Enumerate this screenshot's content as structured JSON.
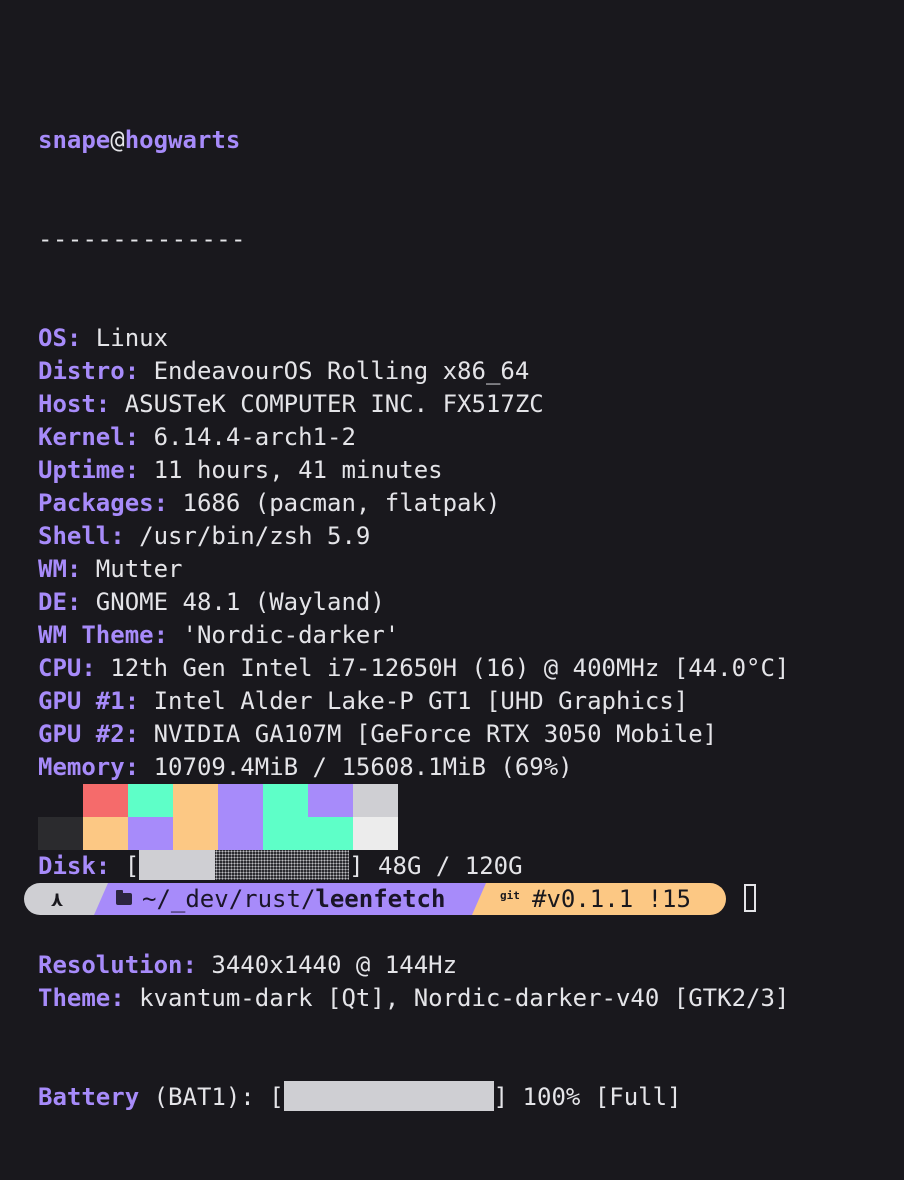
{
  "header": {
    "user": "snape",
    "at": "@",
    "host": "hogwarts",
    "separator": "--------------"
  },
  "info": [
    {
      "label": "OS:",
      "value": " Linux"
    },
    {
      "label": "Distro:",
      "value": " EndeavourOS Rolling x86_64"
    },
    {
      "label": "Host:",
      "value": " ASUSTeK COMPUTER INC. FX517ZC"
    },
    {
      "label": "Kernel:",
      "value": " 6.14.4-arch1-2"
    },
    {
      "label": "Uptime:",
      "value": " 11 hours, 41 minutes"
    },
    {
      "label": "Packages:",
      "value": " 1686 (pacman, flatpak)"
    },
    {
      "label": "Shell:",
      "value": " /usr/bin/zsh 5.9"
    },
    {
      "label": "WM:",
      "value": " Mutter"
    },
    {
      "label": "DE:",
      "value": " GNOME 48.1 (Wayland)"
    },
    {
      "label": "WM Theme:",
      "value": " 'Nordic-darker'"
    },
    {
      "label": "CPU:",
      "value": " 12th Gen Intel i7-12650H (16) @ 400MHz [44.0°C]"
    },
    {
      "label": "GPU #1:",
      "value": " Intel Alder Lake-P GT1 [UHD Graphics]"
    },
    {
      "label": "GPU #2:",
      "value": " NVIDIA GA107M [GeForce RTX 3050 Mobile]"
    },
    {
      "label": "Memory:",
      "value": " 10709.4MiB / 15608.1MiB (69%)"
    }
  ],
  "disk": {
    "label": "Disk:",
    "open": " [",
    "close": "] 48G / 120G",
    "used_fraction": 0.4
  },
  "info2": [
    {
      "label": "Resolution:",
      "value": " 3440x1440 @ 144Hz"
    },
    {
      "label": "Theme:",
      "value": " kvantum-dark [Qt], Nordic-darker-v40 [GTK2/3]"
    }
  ],
  "battery": {
    "label": "Battery",
    "sub": " (BAT1): [",
    "close": "] 100% [Full]",
    "level_fraction": 1.0
  },
  "palette": {
    "row1": [
      "#19181d",
      "#f56b6b",
      "#5effc8",
      "#fcc884",
      "#a78bfa",
      "#5effc8",
      "#a78bfa",
      "#cfcfd3"
    ],
    "row2": [
      "#2b2b2e",
      "#fcc884",
      "#a78bfa",
      "#fcc884",
      "#a78bfa",
      "#5effc8",
      "#5effc8",
      "#ececec"
    ]
  },
  "prompt": {
    "os_glyph": "⋏",
    "path_prefix": "~/_dev/rust/",
    "path_dir": "leenfetch",
    "git_label": "git",
    "branch": "#v0.1.1 !15"
  }
}
